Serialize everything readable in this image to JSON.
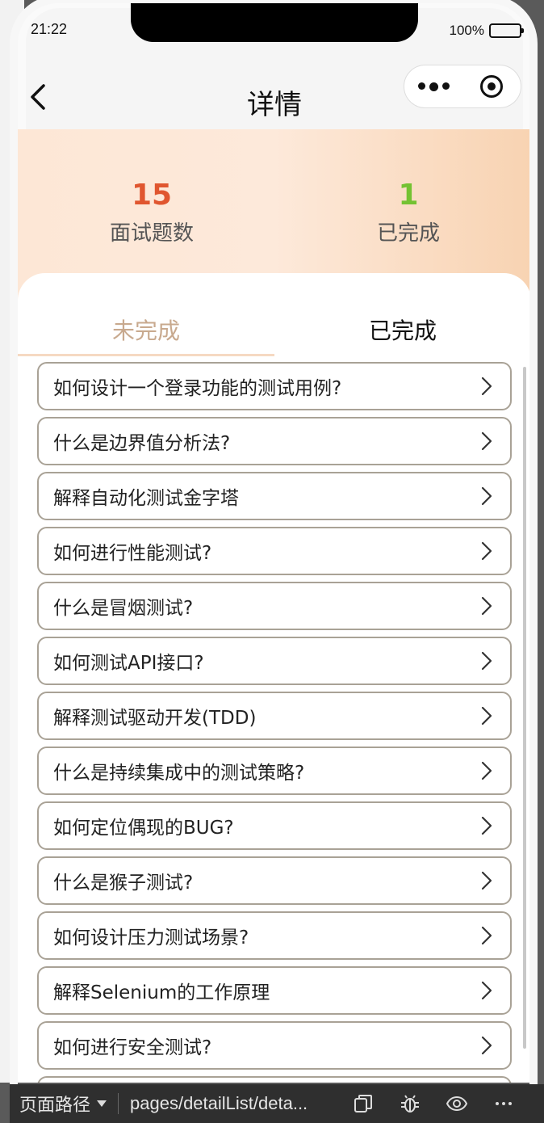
{
  "status_bar": {
    "time": "21:22",
    "battery": "100%"
  },
  "navbar": {
    "title": "详情"
  },
  "stats": {
    "total_count": "15",
    "total_label": "面试题数",
    "done_count": "1",
    "done_label": "已完成"
  },
  "tabs": [
    {
      "label": "未完成",
      "active": true
    },
    {
      "label": "已完成",
      "active": false
    }
  ],
  "questions": [
    "如何设计一个登录功能的测试用例?",
    "什么是边界值分析法?",
    "解释自动化测试金字塔",
    "如何进行性能测试?",
    "什么是冒烟测试?",
    "如何测试API接口?",
    "解释测试驱动开发(TDD)",
    "什么是持续集成中的测试策略?",
    "如何定位偶现的BUG?",
    "什么是猴子测试?",
    "如何设计压力测试场景?",
    "解释Selenium的工作原理",
    "如何进行安全测试?",
    ""
  ],
  "devtools_bar": {
    "path_label": "页面路径",
    "path_value": "pages/detailList/deta..."
  },
  "colors": {
    "total_count": "#e0562f",
    "done_count": "#74c232",
    "tab_active": "#c8a98e",
    "item_border": "#a9a296"
  }
}
